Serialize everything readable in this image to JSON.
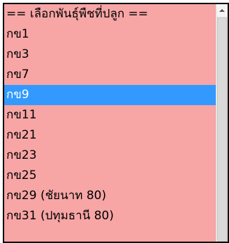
{
  "listbox": {
    "selected_index": 4,
    "options": [
      {
        "label": "== เลือกพันธุ์พืชที่ปลูก =="
      },
      {
        "label": "กข1"
      },
      {
        "label": "กข3"
      },
      {
        "label": "กข7"
      },
      {
        "label": "กข9"
      },
      {
        "label": "กข11"
      },
      {
        "label": "กข21"
      },
      {
        "label": "กข23"
      },
      {
        "label": "กข25"
      },
      {
        "label": "กข29 (ชัยนาท 80)"
      },
      {
        "label": "กข31 (ปทุมธานี 80)"
      }
    ]
  },
  "scrollbar": {
    "up_icon": "triangle-up-icon"
  },
  "colors": {
    "list_background": "#f7a5a5",
    "selection_background": "#3399ff",
    "selection_text": "#ffffff"
  }
}
